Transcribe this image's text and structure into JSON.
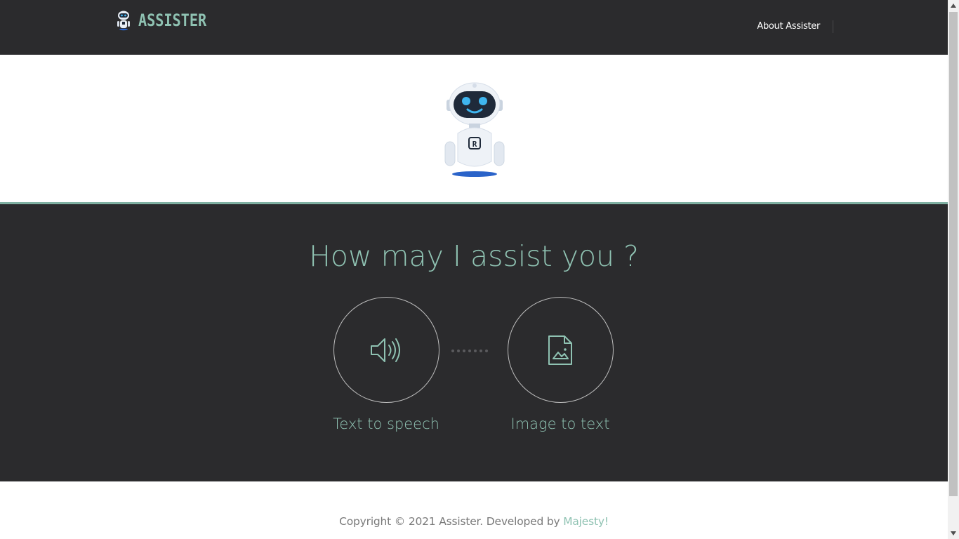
{
  "header": {
    "brand": "ASSISTER",
    "nav_about": "About Assister"
  },
  "hero": {
    "robot_badge": "R"
  },
  "main": {
    "title": "How may I assist you ?",
    "services": [
      {
        "label": "Text to speech",
        "icon": "speaker-icon"
      },
      {
        "label": "Image to text",
        "icon": "image-file-icon"
      }
    ]
  },
  "footer": {
    "copyright": "Copyright © 2021 Assister. Developed by ",
    "developer": "Majesty!"
  },
  "colors": {
    "dark_bg": "#2b2b2d",
    "accent": "#8fc2b2",
    "accent_line": "#7fb0a2"
  }
}
